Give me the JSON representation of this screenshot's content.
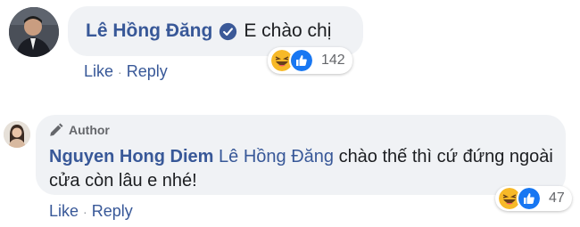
{
  "comment_1": {
    "author": "Lê Hồng Đăng",
    "text": "E chào chị",
    "like_label": "Like",
    "separator": "·",
    "reply_label": "Reply",
    "reaction_count": "142"
  },
  "comment_2": {
    "badge": "Author",
    "author": "Nguyen Hong Diem",
    "mention": "Lê Hồng Đăng",
    "text": "chào thế thì cứ đứng ngoài cửa còn lâu e nhé!",
    "like_label": "Like",
    "separator": "·",
    "reply_label": "Reply",
    "reaction_count": "47"
  },
  "colors": {
    "link": "#385898",
    "bubble": "#f0f2f5",
    "like_blue": "#1877f2",
    "haha_yellow": "#f7b928",
    "verified": "#1877f2"
  },
  "icons": [
    "verified-icon",
    "haha-icon",
    "like-icon",
    "pencil-icon"
  ]
}
